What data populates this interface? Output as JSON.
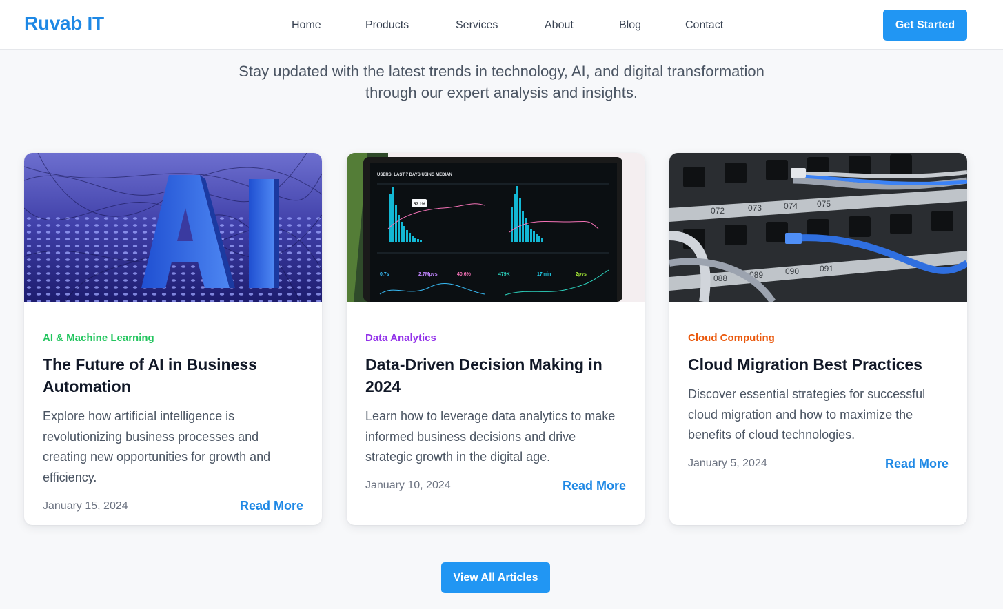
{
  "header": {
    "brand": "Ruvab IT",
    "nav": [
      "Home",
      "Products",
      "Services",
      "About",
      "Blog",
      "Contact"
    ],
    "cta": "Get Started"
  },
  "intro": {
    "line1": "Stay updated with the latest trends in technology, AI, and digital transformation",
    "line2": "through our expert analysis and insights."
  },
  "posts": [
    {
      "category": "AI & Machine Learning",
      "category_color": "#22c55e",
      "title": "The Future of AI in Business Automation",
      "excerpt": "Explore how artificial intelligence is revolutionizing business processes and creating new opportunities for growth and efficiency.",
      "date": "January 15, 2024",
      "read_more": "Read More",
      "image": "ai-letters-illustration"
    },
    {
      "category": "Data Analytics",
      "category_color": "#9333ea",
      "title": "Data-Driven Decision Making in 2024",
      "excerpt": "Learn how to leverage data analytics to make informed business decisions and drive strategic growth in the digital age.",
      "date": "January 10, 2024",
      "read_more": "Read More",
      "image": "analytics-dashboard-laptop",
      "image_text": {
        "dashboard_header": "USERS: LAST 7 DAYS USING MEDIAN",
        "tooltip": "57.1%",
        "stats": [
          "0.7s",
          "2.7Mpvs",
          "40.6%",
          "479K",
          "17min",
          "2pvs"
        ]
      }
    },
    {
      "category": "Cloud Computing",
      "category_color": "#ea580c",
      "title": "Cloud Migration Best Practices",
      "excerpt": "Discover essential strategies for successful cloud migration and how to maximize the benefits of cloud technologies.",
      "date": "January 5, 2024",
      "read_more": "Read More",
      "image": "network-patch-panel",
      "image_text": {
        "port_labels": [
          "072",
          "073",
          "074",
          "075",
          "088",
          "089",
          "090",
          "091"
        ]
      }
    }
  ],
  "view_all": "View All Articles"
}
